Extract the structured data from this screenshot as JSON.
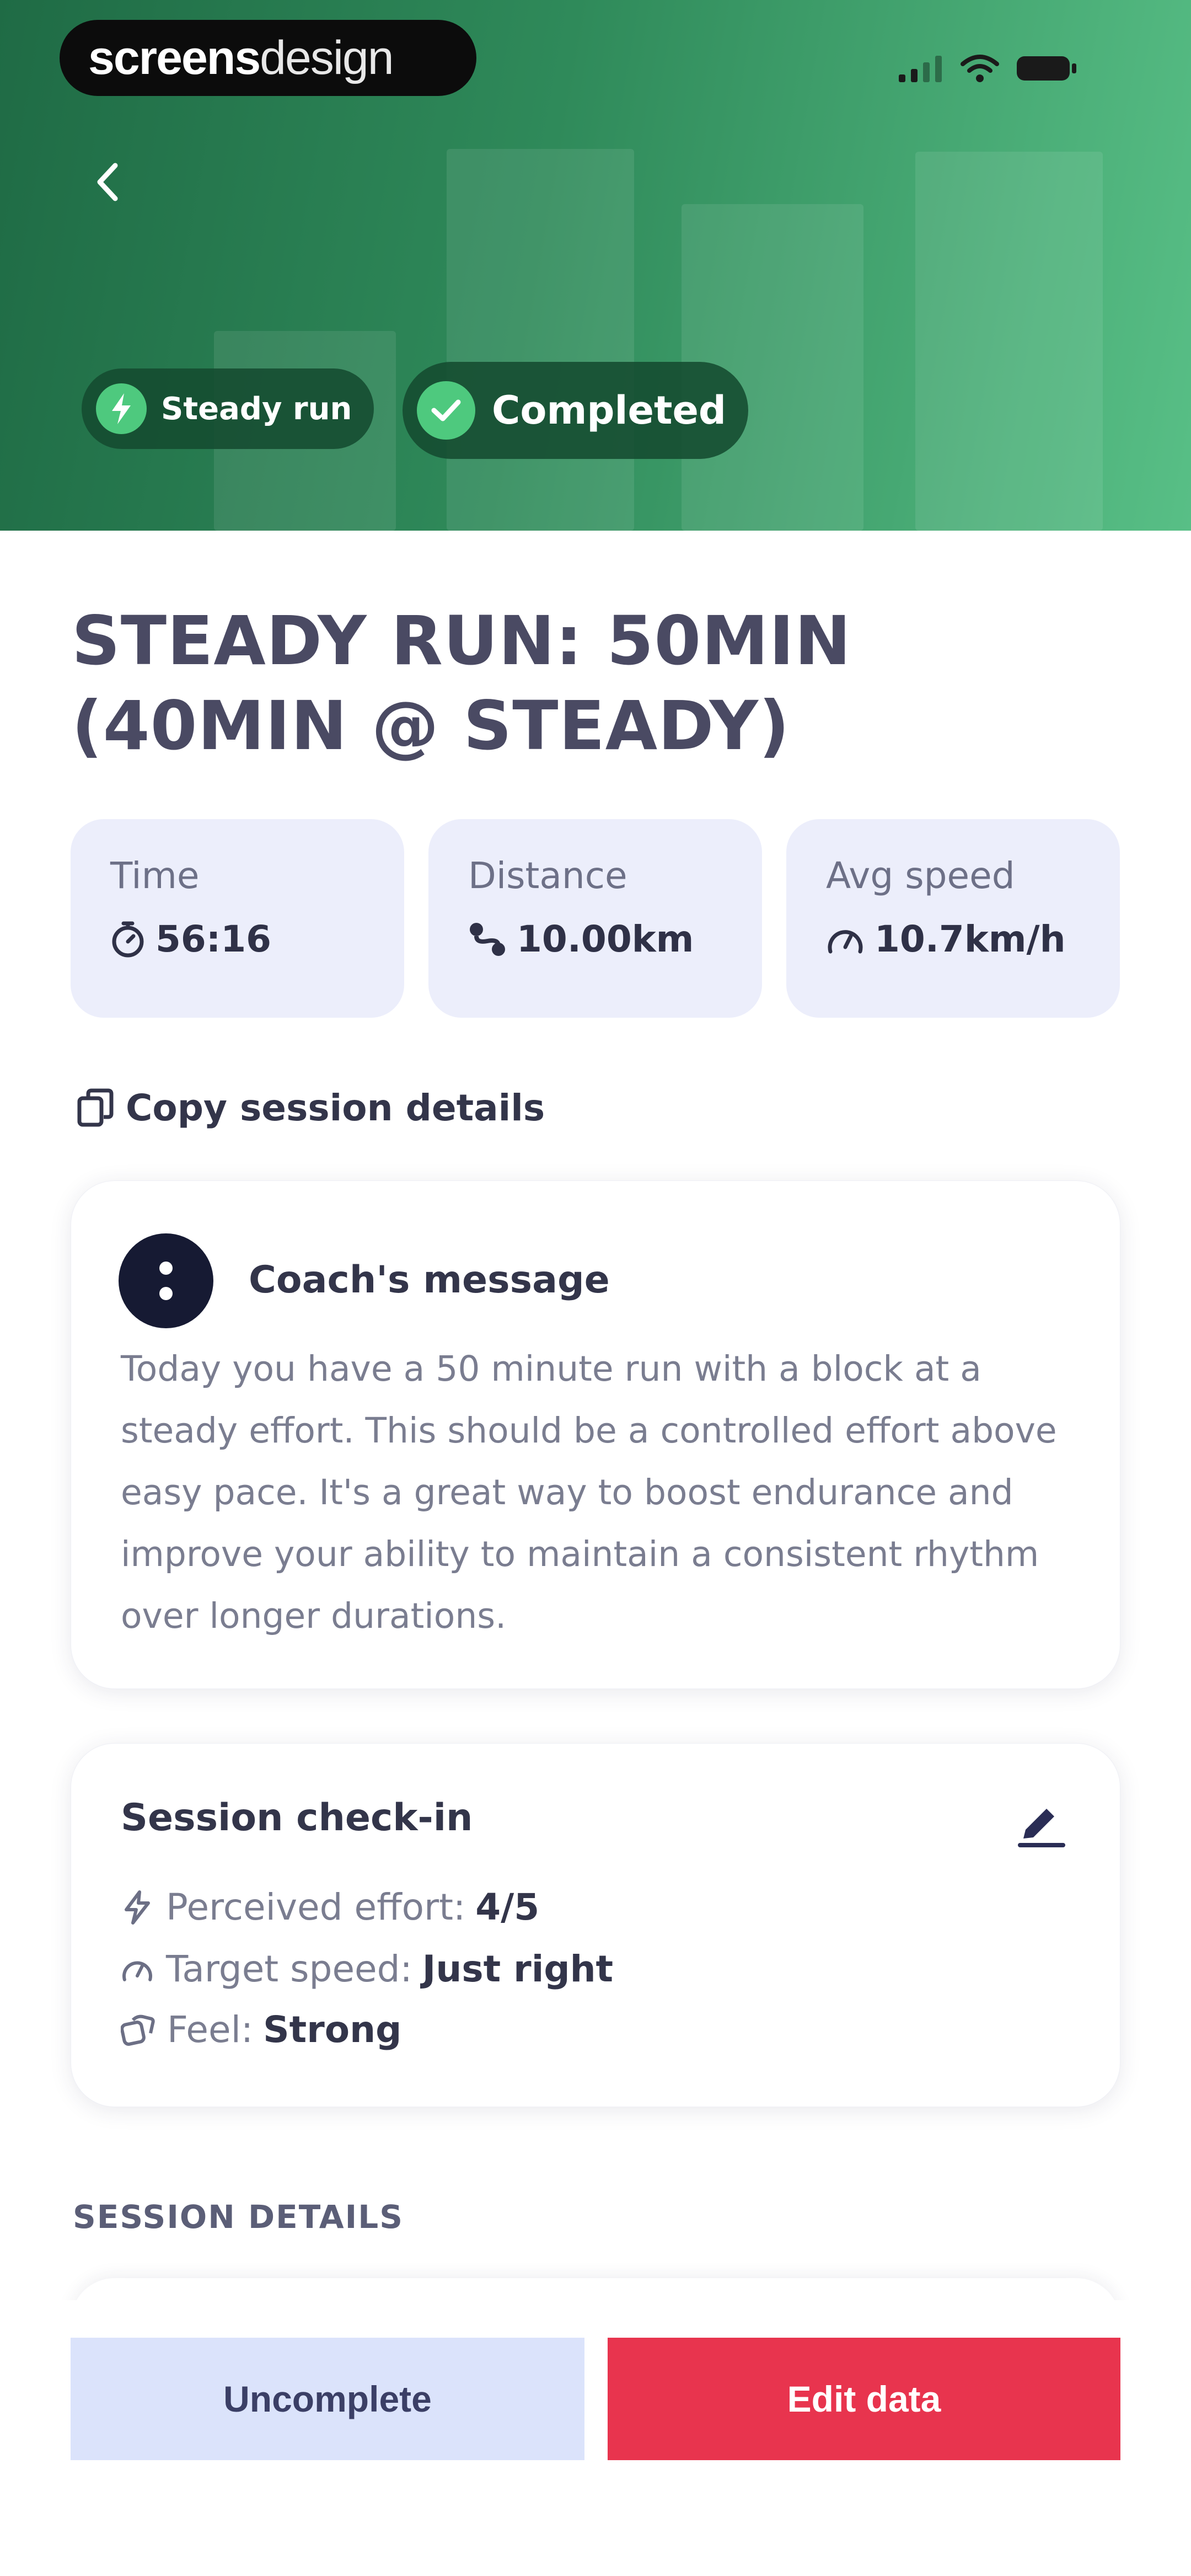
{
  "watermark": {
    "bold": "screens",
    "light": "design"
  },
  "header": {
    "chips": [
      {
        "label": "Steady run",
        "icon": "lightning-icon"
      },
      {
        "label": "Completed",
        "icon": "check-circle-icon"
      }
    ]
  },
  "title": "STEADY RUN: 50MIN (40MIN @ STEADY)",
  "stats": [
    {
      "label": "Time",
      "value": "56:16",
      "icon": "stopwatch-icon"
    },
    {
      "label": "Distance",
      "value": "10.00km",
      "icon": "route-icon"
    },
    {
      "label": "Avg speed",
      "value": "10.7km/h",
      "icon": "speedometer-icon"
    }
  ],
  "copy_link": "Copy session details",
  "coach": {
    "title": "Coach's message",
    "message": "Today you have a 50 minute run with a block at a steady effort. This should be a controlled effort above easy pace. It's a great way to boost endurance and improve your ability to maintain a consistent rhythm over longer durations."
  },
  "checkin": {
    "title": "Session check-in",
    "rows": [
      {
        "label": "Perceived effort:",
        "value": "4/5",
        "icon": "effort-icon"
      },
      {
        "label": "Target speed:",
        "value": "Just right",
        "icon": "speedometer-icon"
      },
      {
        "label": "Feel:",
        "value": "Strong",
        "icon": "feel-icon"
      }
    ]
  },
  "section_label": "SESSION DETAILS",
  "buttons": {
    "uncomplete": "Uncomplete",
    "edit": "Edit data"
  },
  "colors": {
    "hero_start": "#1f6b45",
    "hero_end": "#58bf86",
    "edit_button": "#e8344e",
    "uncomplete_button": "#dbe3fb",
    "stat_card": "#eceefb"
  }
}
